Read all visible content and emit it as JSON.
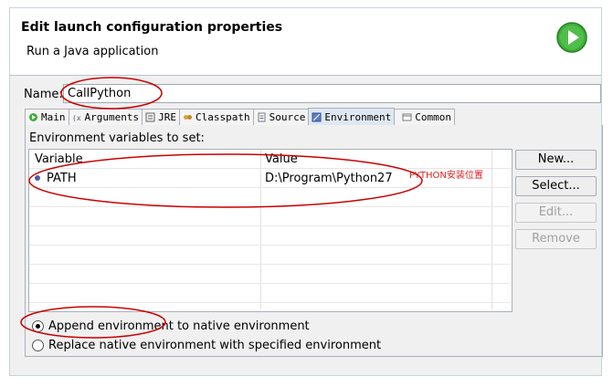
{
  "header": {
    "title": "Edit launch configuration properties",
    "subtitle": "Run a Java application"
  },
  "name_field": {
    "label": "Name:",
    "value": "CallPython"
  },
  "tabs": [
    {
      "label": "Main",
      "icon": "main-icon"
    },
    {
      "label": "Arguments",
      "icon": "arguments-icon"
    },
    {
      "label": "JRE",
      "icon": "jre-icon"
    },
    {
      "label": "Classpath",
      "icon": "classpath-icon"
    },
    {
      "label": "Source",
      "icon": "source-icon"
    },
    {
      "label": "Environment",
      "icon": "environment-icon",
      "active": true
    },
    {
      "label": "Common",
      "icon": "common-icon"
    }
  ],
  "environment": {
    "label": "Environment variables to set:",
    "columns": [
      "Variable",
      "Value"
    ],
    "rows": [
      {
        "variable": "PATH",
        "value": "D:\\Program\\Python27"
      }
    ]
  },
  "buttons": {
    "new": "New...",
    "select": "Select...",
    "edit": "Edit...",
    "remove": "Remove"
  },
  "options": {
    "append": "Append environment to native environment",
    "replace": "Replace native environment with specified environment",
    "selected": "append"
  },
  "annotation": "PYTHON安装位置",
  "colors": {
    "annotation_red": "#e02020",
    "run_icon_green": "#3fae3a"
  }
}
